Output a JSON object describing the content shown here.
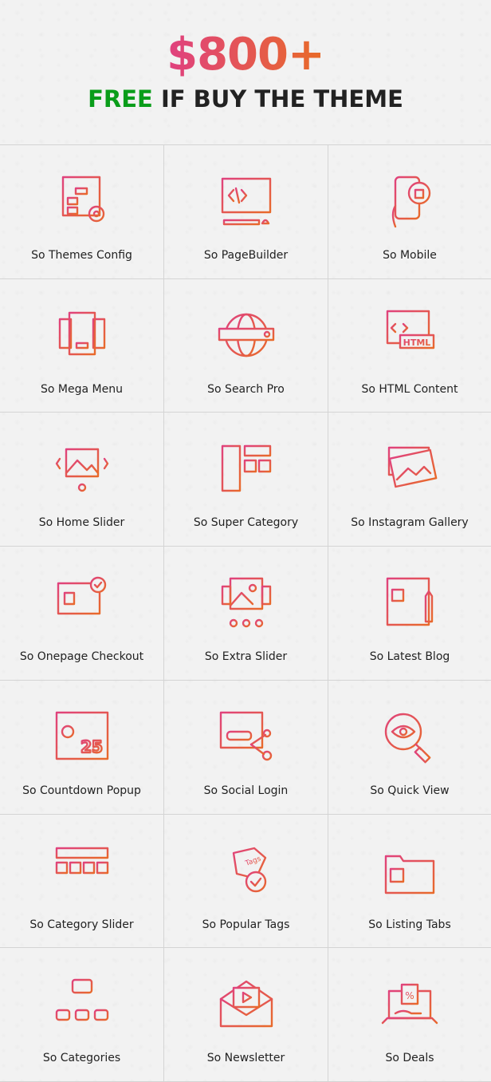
{
  "header": {
    "price": "$800+",
    "free": "FREE",
    "rest": " IF BUY THE THEME"
  },
  "colors": {
    "gradient_start": "#e0427d",
    "gradient_end": "#e86a2a",
    "free_green": "#0a9d1a",
    "text": "#222222"
  },
  "modules": [
    {
      "label": "So Themes Config",
      "icon": "settings-window-icon"
    },
    {
      "label": "So PageBuilder",
      "icon": "code-monitor-icon"
    },
    {
      "label": "So Mobile",
      "icon": "mobile-shopping-icon"
    },
    {
      "label": "So Mega Menu",
      "icon": "mega-menu-icon"
    },
    {
      "label": "So Search Pro",
      "icon": "globe-search-icon"
    },
    {
      "label": "So HTML Content",
      "icon": "html-window-icon"
    },
    {
      "label": "So Home Slider",
      "icon": "image-slider-icon"
    },
    {
      "label": "So Super Category",
      "icon": "layout-grid-icon"
    },
    {
      "label": "So Instagram Gallery",
      "icon": "photo-stack-icon"
    },
    {
      "label": "So Onepage Checkout",
      "icon": "checkout-monitor-icon"
    },
    {
      "label": "So Extra Slider",
      "icon": "slider-cart-icon"
    },
    {
      "label": "So Latest Blog",
      "icon": "blog-page-icon"
    },
    {
      "label": "So Countdown Popup",
      "icon": "countdown-calendar-icon"
    },
    {
      "label": "So Social Login",
      "icon": "social-login-icon"
    },
    {
      "label": "So Quick View",
      "icon": "eye-magnifier-icon"
    },
    {
      "label": "So Category Slider",
      "icon": "category-slider-icon"
    },
    {
      "label": "So Popular Tags",
      "icon": "tags-icon"
    },
    {
      "label": "So Listing Tabs",
      "icon": "folder-tabs-icon"
    },
    {
      "label": "So Categories",
      "icon": "hierarchy-icon"
    },
    {
      "label": "So Newsletter",
      "icon": "newsletter-envelope-icon"
    },
    {
      "label": "So Deals",
      "icon": "laptop-deals-icon"
    }
  ]
}
